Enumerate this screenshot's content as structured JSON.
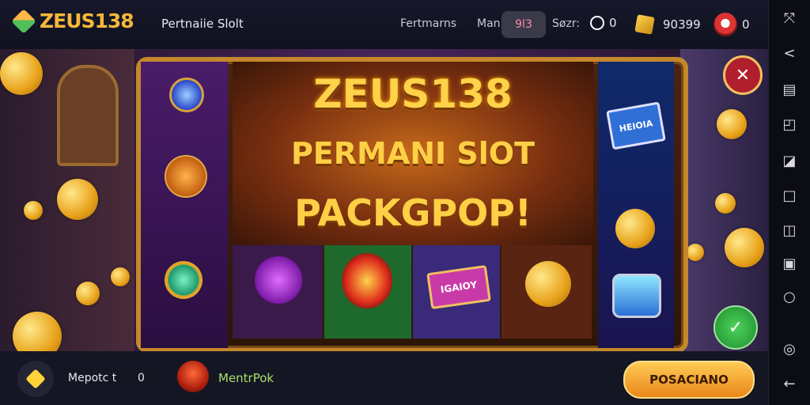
{
  "header": {
    "brand": "ZEUS138",
    "nav_title": "Pertnaiie Slolt",
    "links": [
      "Fertmarns",
      "Man"
    ],
    "badge": "9l3",
    "sort_label": "Søzr:",
    "coins_value": "0",
    "gold_value": "90399",
    "avatar_value": "0"
  },
  "banner": {
    "line1": "ZEUS138",
    "line2": "PERMANI SlOT",
    "line3": "PACKGPOP!",
    "card_label_top": "HEIOIA",
    "card_label_bottom": "IGAIOY"
  },
  "bottom_bar": {
    "left_label": "Mepotc t",
    "left_count": "0",
    "middle_label": "MentrPok",
    "cta_label": "POSACIANO"
  },
  "colors": {
    "accent_gold": "#f6b73a",
    "close_red": "#b01f2c",
    "confirm_green": "#1d8d2c"
  }
}
